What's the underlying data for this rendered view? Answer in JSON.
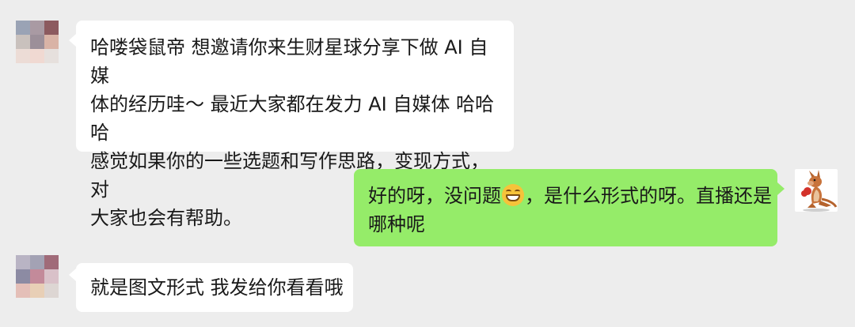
{
  "messages": [
    {
      "side": "left",
      "sender": "other",
      "text_lines": [
        "哈喽袋鼠帝 想邀请你来生财星球分享下做 AI 自媒",
        "体的经历哇～ 最近大家都在发力 AI 自媒体  哈哈哈",
        "感觉如果你的一些选题和写作思路，变现方式，对",
        "大家也会有帮助。"
      ]
    },
    {
      "side": "right",
      "sender": "self",
      "text_before_emoji": "好的呀，没问题",
      "emoji": "grinning-face-emoji",
      "text_after_emoji": "，是什么形式的呀。直播还是",
      "text_line2": "哪种呢"
    },
    {
      "side": "left",
      "sender": "other",
      "text_lines": [
        "就是图文形式  我发给你看看哦"
      ]
    }
  ],
  "colors": {
    "background": "#ededed",
    "bubble_other": "#ffffff",
    "bubble_self": "#95ec69",
    "text": "#191919"
  }
}
